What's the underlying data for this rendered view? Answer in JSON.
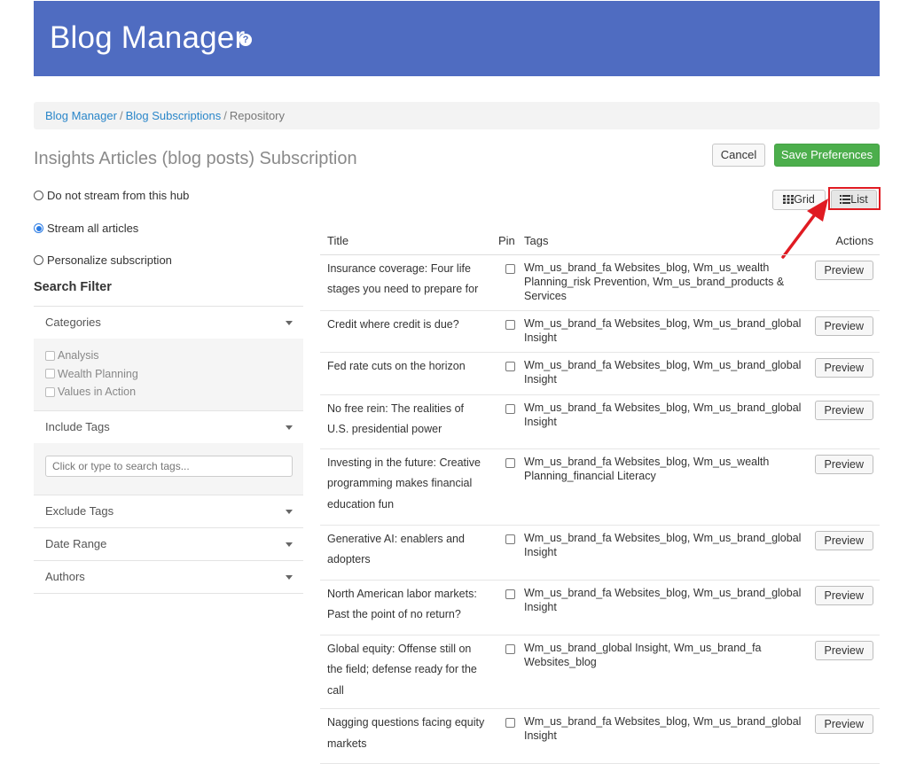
{
  "header": {
    "title": "Blog Manager",
    "help_icon": "?"
  },
  "breadcrumb": {
    "items": [
      "Blog Manager",
      "Blog Subscriptions"
    ],
    "separator": "/",
    "current": "Repository"
  },
  "page": {
    "title": "Insights Articles (blog posts) Subscription"
  },
  "buttons": {
    "cancel": "Cancel",
    "save": "Save Preferences",
    "grid": "Grid",
    "list": "List"
  },
  "stream_options": [
    {
      "label": "Do not stream from this hub",
      "checked": false
    },
    {
      "label": "Stream all articles",
      "checked": true
    },
    {
      "label": "Personalize subscription",
      "checked": false
    }
  ],
  "search_filter": {
    "title": "Search Filter",
    "categories": {
      "label": "Categories",
      "options": [
        "Analysis",
        "Wealth Planning",
        "Values in Action"
      ]
    },
    "include_tags": {
      "label": "Include Tags",
      "placeholder": "Click or type to search tags..."
    },
    "exclude_tags": {
      "label": "Exclude Tags"
    },
    "date_range": {
      "label": "Date Range"
    },
    "authors": {
      "label": "Authors"
    }
  },
  "table": {
    "headers": {
      "title": "Title",
      "pin": "Pin",
      "tags": "Tags",
      "actions": "Actions"
    },
    "rows": [
      {
        "title": "Insurance coverage: Four life stages you need to prepare for",
        "tags": "Wm_us_brand_fa Websites_blog, Wm_us_wealth Planning_risk Prevention, Wm_us_brand_products & Services",
        "action": "Preview"
      },
      {
        "title": "Credit where credit is due?",
        "tags": "Wm_us_brand_fa Websites_blog, Wm_us_brand_global Insight",
        "action": "Preview"
      },
      {
        "title": "Fed rate cuts on the horizon",
        "tags": "Wm_us_brand_fa Websites_blog, Wm_us_brand_global Insight",
        "action": "Preview"
      },
      {
        "title": "No free rein: The realities of U.S. presidential power",
        "tags": "Wm_us_brand_fa Websites_blog, Wm_us_brand_global Insight",
        "action": "Preview"
      },
      {
        "title": "Investing in the future: Creative programming makes financial education fun",
        "tags": "Wm_us_brand_fa Websites_blog, Wm_us_wealth Planning_financial Literacy",
        "action": "Preview"
      },
      {
        "title": "Generative AI: enablers and adopters",
        "tags": "Wm_us_brand_fa Websites_blog, Wm_us_brand_global Insight",
        "action": "Preview"
      },
      {
        "title": "North American labor markets: Past the point of no return?",
        "tags": "Wm_us_brand_fa Websites_blog, Wm_us_brand_global Insight",
        "action": "Preview"
      },
      {
        "title": "Global equity: Offense still on the field; defense ready for the call",
        "tags": "Wm_us_brand_global Insight, Wm_us_brand_fa Websites_blog",
        "action": "Preview"
      },
      {
        "title": "Nagging questions facing equity markets",
        "tags": "Wm_us_brand_fa Websites_blog, Wm_us_brand_global Insight",
        "action": "Preview"
      }
    ]
  },
  "annotation": {
    "color": "#e01b22"
  }
}
